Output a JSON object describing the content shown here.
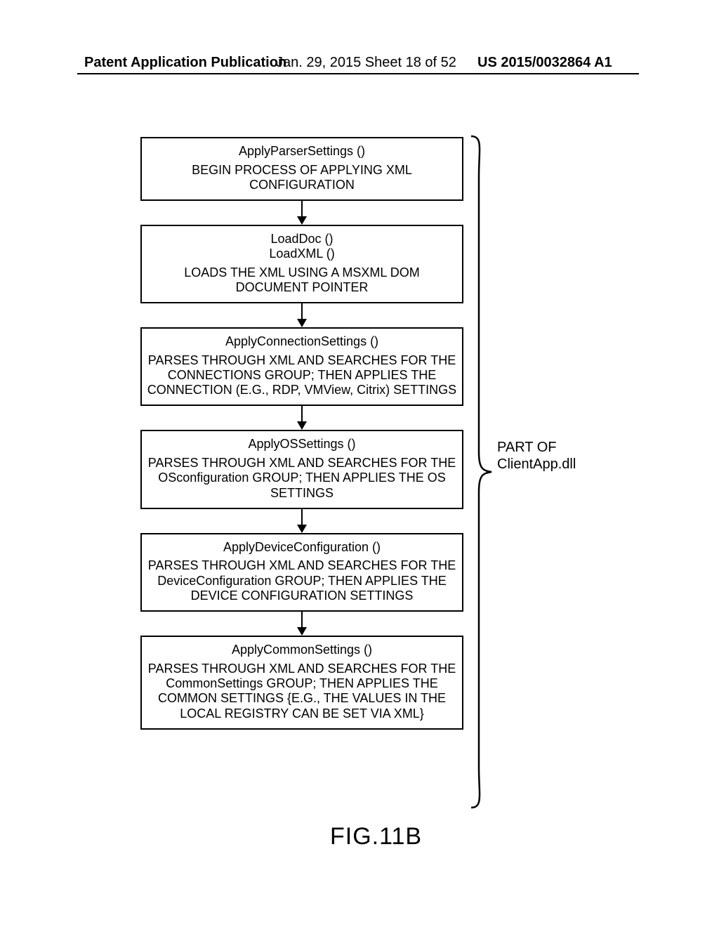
{
  "header": {
    "left": "Patent Application Publication",
    "mid": "Jan. 29, 2015  Sheet 18 of 52",
    "right": "US 2015/0032864 A1"
  },
  "boxes": [
    {
      "fn": "ApplyParserSettings ()",
      "desc": "BEGIN PROCESS OF APPLYING XML CONFIGURATION"
    },
    {
      "fn": "LoadDoc ()\nLoadXML ()",
      "desc": "LOADS THE XML USING A MSXML DOM DOCUMENT POINTER"
    },
    {
      "fn": "ApplyConnectionSettings ()",
      "desc": "PARSES THROUGH XML AND SEARCHES FOR THE CONNECTIONS GROUP; THEN APPLIES THE CONNECTION (E.G., RDP, VMView, Citrix) SETTINGS"
    },
    {
      "fn": "ApplyOSSettings ()",
      "desc": "PARSES THROUGH XML AND SEARCHES FOR THE OSconfiguration GROUP; THEN APPLIES THE OS SETTINGS"
    },
    {
      "fn": "ApplyDeviceConfiguration ()",
      "desc": "PARSES THROUGH XML AND SEARCHES FOR THE DeviceConfiguration GROUP; THEN APPLIES THE DEVICE CONFIGURATION SETTINGS"
    },
    {
      "fn": "ApplyCommonSettings ()",
      "desc": "PARSES THROUGH XML AND SEARCHES FOR THE CommonSettings GROUP; THEN APPLIES THE COMMON SETTINGS {E.G., THE VALUES IN THE LOCAL REGISTRY CAN BE SET VIA XML}"
    }
  ],
  "brace_label_line1": "PART OF",
  "brace_label_line2": "ClientApp.dll",
  "figure_label": "FIG.11B"
}
